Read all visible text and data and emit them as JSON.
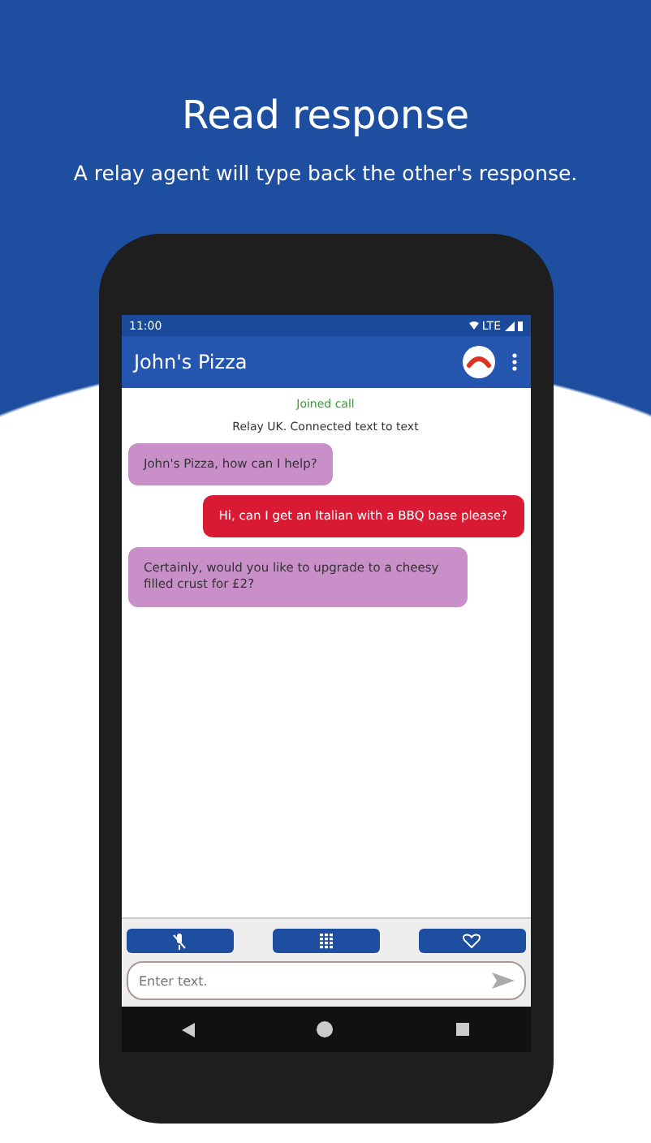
{
  "heading": {
    "title": "Read response",
    "subtitle": "A relay agent will type back the other's response."
  },
  "status_bar": {
    "time": "11:00",
    "network": "LTE"
  },
  "app_bar": {
    "title": "John's Pizza"
  },
  "call_status": [
    {
      "kind": "joined",
      "text": "Joined call"
    },
    {
      "kind": "info",
      "text": "Relay UK. Connected text to text"
    }
  ],
  "messages": [
    {
      "kind": "incoming",
      "text": "John's Pizza, how can I help?",
      "color": "#c98fc9"
    },
    {
      "kind": "outgoing",
      "text": "Hi, can I get an Italian with a BBQ base please?",
      "color": "#d81b32"
    },
    {
      "kind": "incoming",
      "text": "Certainly, would you like to upgrade to a cheesy filled crust for £2?",
      "color": "#c98fc9"
    }
  ],
  "input": {
    "placeholder": "Enter text."
  }
}
